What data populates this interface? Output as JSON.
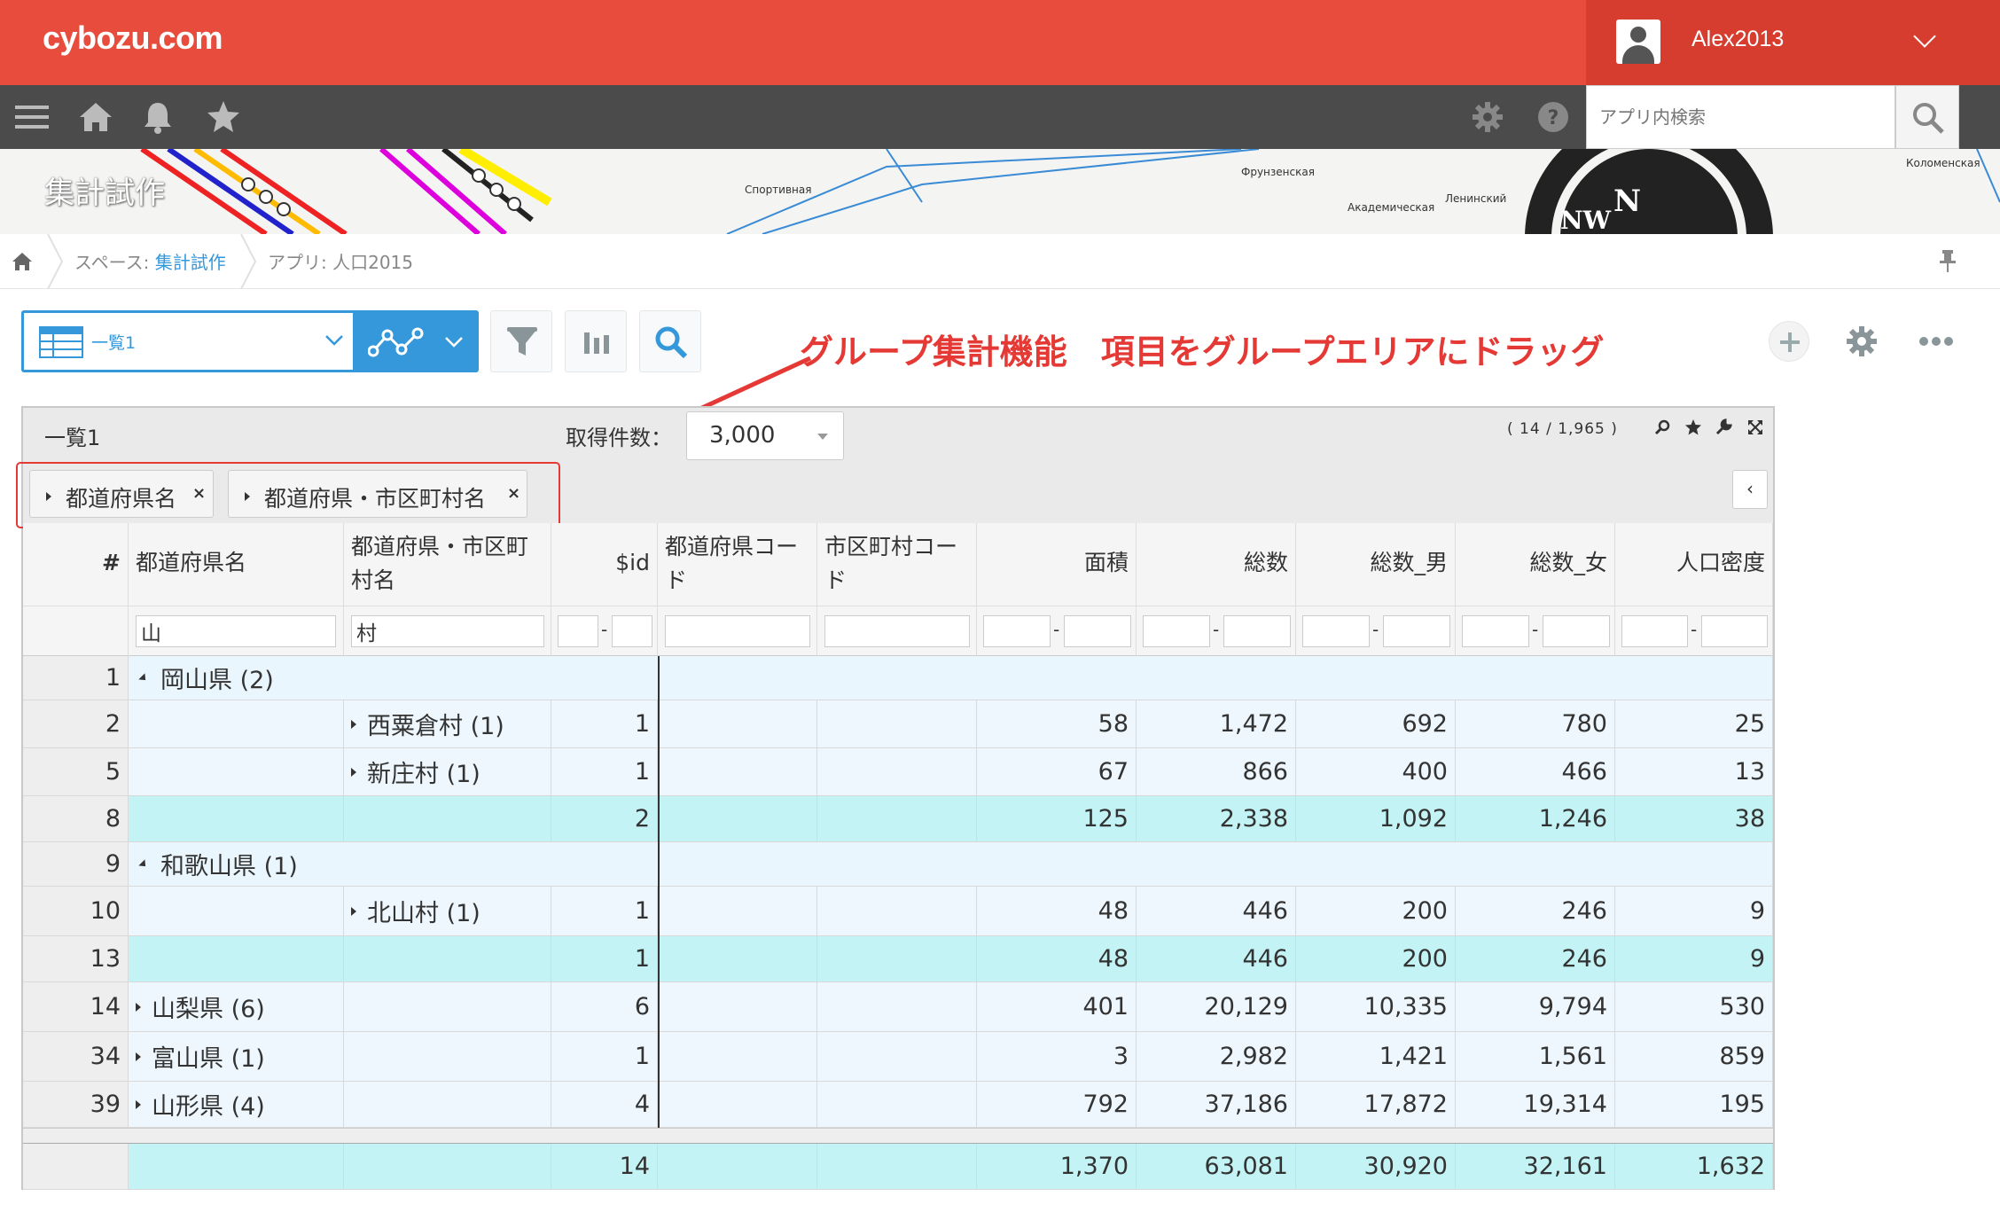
{
  "app": {
    "logo": "cybozu.com",
    "username": "Alex2013"
  },
  "search": {
    "placeholder": "アプリ内検索"
  },
  "banner": {
    "title": "集計試作"
  },
  "breadcrumb": {
    "space_prefix": "スペース: ",
    "space_name": "集計試作",
    "app_label": "アプリ: 人口2015"
  },
  "toolbar": {
    "view_name": "一覧1"
  },
  "callout": "グループ集計機能　項目をグループエリアにドラッグ",
  "panel": {
    "title": "一覧1",
    "fetch_label": "取得件数：",
    "fetch_value": "3,000",
    "counts": "( 14 / 1,965 )"
  },
  "groups": [
    {
      "label": "都道府県名",
      "remove": "×"
    },
    {
      "label": "都道府県・市区町村名",
      "remove": "×"
    }
  ],
  "collapse_label": "‹",
  "columns": {
    "index": "#",
    "pref": "都道府県名",
    "city": "都道府県・市区町村名",
    "id": "$id",
    "prefcode": "都道府県コード",
    "citycode": "市区町村コード",
    "area": "面積",
    "total": "総数",
    "male": "総数_男",
    "female": "総数_女",
    "density": "人口密度"
  },
  "filters": {
    "pref": "山",
    "city": "村",
    "range_sep": "-"
  },
  "rows": [
    {
      "type": "group",
      "idx": "1",
      "label": "岡山県 (2)",
      "expanded": true
    },
    {
      "type": "sub",
      "idx": "2",
      "city": "西粟倉村 (1)",
      "id": "1",
      "area": "58",
      "total": "1,472",
      "male": "692",
      "female": "780",
      "density": "25"
    },
    {
      "type": "sub",
      "idx": "5",
      "city": "新庄村 (1)",
      "id": "1",
      "area": "67",
      "total": "866",
      "male": "400",
      "female": "466",
      "density": "13"
    },
    {
      "type": "sum",
      "idx": "8",
      "id": "2",
      "area": "125",
      "total": "2,338",
      "male": "1,092",
      "female": "1,246",
      "density": "38"
    },
    {
      "type": "group",
      "idx": "9",
      "label": "和歌山県 (1)",
      "expanded": true
    },
    {
      "type": "sub",
      "idx": "10",
      "city": "北山村 (1)",
      "id": "1",
      "area": "48",
      "total": "446",
      "male": "200",
      "female": "246",
      "density": "9"
    },
    {
      "type": "sum",
      "idx": "13",
      "id": "1",
      "area": "48",
      "total": "446",
      "male": "200",
      "female": "246",
      "density": "9"
    },
    {
      "type": "collapsed",
      "idx": "14",
      "label": "山梨県 (6)",
      "id": "6",
      "area": "401",
      "total": "20,129",
      "male": "10,335",
      "female": "9,794",
      "density": "530"
    },
    {
      "type": "collapsed",
      "idx": "34",
      "label": "富山県 (1)",
      "id": "1",
      "area": "3",
      "total": "2,982",
      "male": "1,421",
      "female": "1,561",
      "density": "859"
    },
    {
      "type": "collapsed",
      "idx": "39",
      "label": "山形県 (4)",
      "id": "4",
      "area": "792",
      "total": "37,186",
      "male": "17,872",
      "female": "19,314",
      "density": "195"
    }
  ],
  "totals": {
    "id": "14",
    "area": "1,370",
    "total": "63,081",
    "male": "30,920",
    "female": "32,161",
    "density": "1,632"
  },
  "colors": {
    "brand_red": "#e74c3c",
    "nav_dark": "#4b4b4b",
    "accent_blue": "#3498db",
    "group_row": "#eaf6fd",
    "sum_row": "#c3f3f4",
    "callout_red": "#e53935"
  },
  "icons": [
    "menu-icon",
    "home-icon",
    "bell-icon",
    "star-icon",
    "gear-icon",
    "help-icon",
    "search-icon",
    "table-icon",
    "graph-icon",
    "filter-icon",
    "bar-chart-icon",
    "pin-icon",
    "plus-icon",
    "more-icon"
  ]
}
